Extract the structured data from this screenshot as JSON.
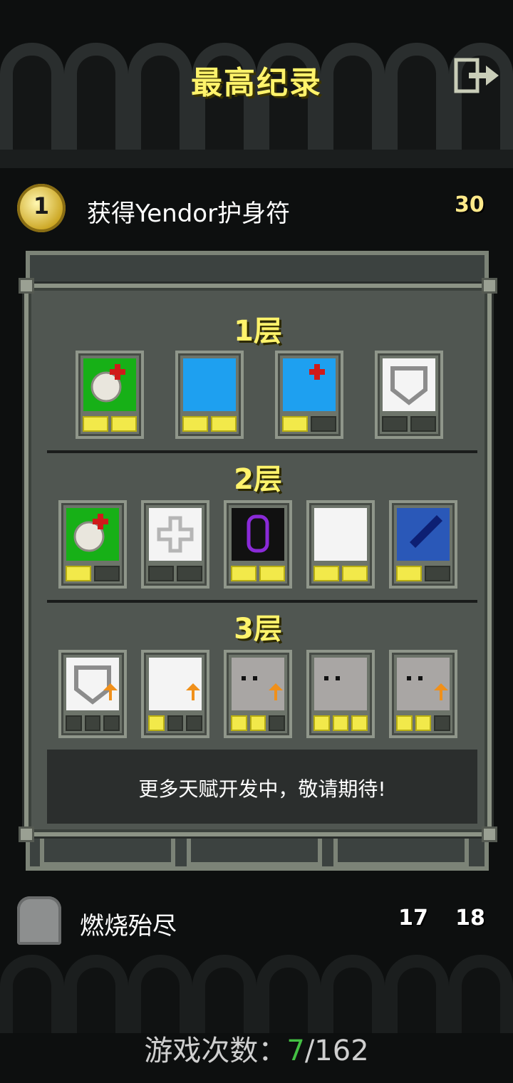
{
  "header": {
    "title": "最高纪录"
  },
  "records": [
    {
      "rank": "1",
      "text": "获得Yendor护身符",
      "level": "30"
    },
    {
      "text": "燃烧殆尽",
      "depth": "17",
      "level": "18"
    }
  ],
  "talents": {
    "tiers": [
      {
        "label": "1层",
        "items": [
          {
            "name": "talent-heal-shield",
            "points": [
              1,
              1
            ],
            "bg": "#17b017"
          },
          {
            "name": "talent-weapon-armor-id",
            "points": [
              1,
              1
            ],
            "bg": "#1ea0f0"
          },
          {
            "name": "talent-id-heal",
            "points": [
              1,
              0
            ],
            "bg": "#1ea0f0"
          },
          {
            "name": "talent-armor-shield",
            "points": [
              0,
              0
            ],
            "bg": "#f4f4f4"
          }
        ]
      },
      {
        "label": "2层",
        "items": [
          {
            "name": "talent-heal-armor",
            "points": [
              1,
              0
            ],
            "bg": "#17b017"
          },
          {
            "name": "talent-cross",
            "points": [
              0,
              0
            ],
            "bg": "#f4f4f4"
          },
          {
            "name": "talent-purple-key",
            "points": [
              1,
              1
            ],
            "bg": "#111111"
          },
          {
            "name": "talent-skulls",
            "points": [
              1,
              1
            ],
            "bg": "#f4f4f4"
          },
          {
            "name": "talent-rocket-eye",
            "points": [
              1,
              0
            ],
            "bg": "#2a58b8"
          }
        ]
      },
      {
        "label": "3层",
        "items": [
          {
            "name": "talent-armor-up",
            "points": [
              0,
              0,
              0
            ],
            "bg": "#f4f4f4"
          },
          {
            "name": "talent-weapons-up",
            "points": [
              1,
              0,
              0
            ],
            "bg": "#f4f4f4"
          },
          {
            "name": "talent-face-up",
            "points": [
              1,
              1,
              0
            ],
            "bg": "#a9a6a4"
          },
          {
            "name": "talent-face-shield",
            "points": [
              1,
              1,
              1
            ],
            "bg": "#a9a6a4"
          },
          {
            "name": "talent-face-up-2",
            "points": [
              1,
              1,
              0
            ],
            "bg": "#a9a6a4"
          }
        ]
      }
    ],
    "footer": "更多天赋开发中，敬请期待!"
  },
  "stats": {
    "label": "游戏次数：",
    "current": "7",
    "total": "/162"
  },
  "colors": {
    "accent": "#fff36b",
    "pip_on": "#f2e94a",
    "current_count": "#43c043"
  }
}
